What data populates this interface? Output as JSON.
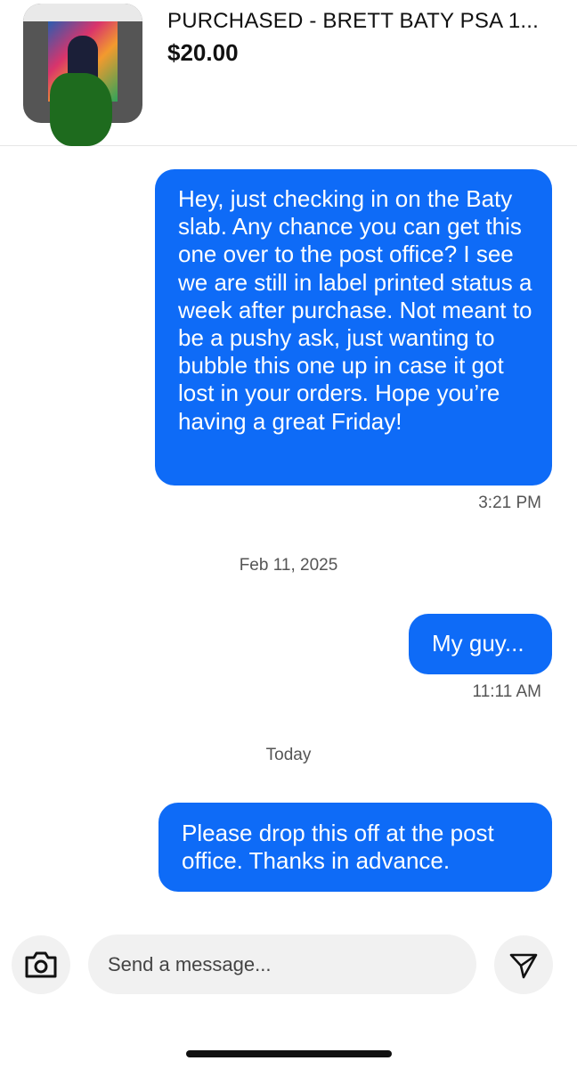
{
  "header": {
    "title": "PURCHASED - BRETT BATY PSA 1...",
    "price": "$20.00",
    "thumbnail_icon": "psa-card-thumbnail"
  },
  "messages": [
    {
      "sender": "me",
      "text": "Hey, just checking in on the Baty slab. Any chance you can get this one over to the post office? I see we are still in label printed status a week after purchase. Not meant to be a pushy ask, just wanting to bubble this one up in case it got lost in your orders. Hope you’re having a great Friday!",
      "time": "3:21 PM"
    },
    {
      "date_separator": "Feb 11, 2025"
    },
    {
      "sender": "me",
      "text": "My guy...",
      "time": "11:11 AM"
    },
    {
      "date_separator": "Today"
    },
    {
      "sender": "me",
      "text": "Please drop this off at the post office. Thanks in advance."
    }
  ],
  "composer": {
    "placeholder": "Send a message...",
    "camera_icon": "camera-icon",
    "send_icon": "send-icon"
  },
  "colors": {
    "bubble": "#0e6bf7",
    "bubble_text": "#ffffff",
    "meta_text": "#555555",
    "input_bg": "#f1f1f1"
  }
}
